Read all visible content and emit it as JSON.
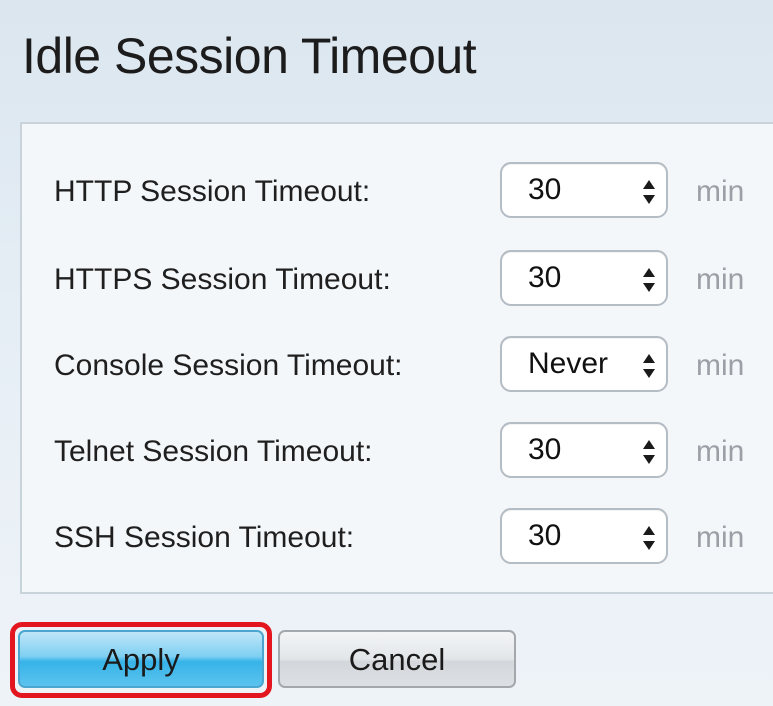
{
  "section": {
    "title": "Idle Session Timeout"
  },
  "settings": [
    {
      "label": "HTTP Session Timeout:",
      "value": "30",
      "unit": "min"
    },
    {
      "label": "HTTPS Session Timeout:",
      "value": "30",
      "unit": "min"
    },
    {
      "label": "Console Session Timeout:",
      "value": "Never",
      "unit": "min"
    },
    {
      "label": "Telnet Session Timeout:",
      "value": "30",
      "unit": "min"
    },
    {
      "label": "SSH Session Timeout:",
      "value": "30",
      "unit": "min"
    }
  ],
  "actions": {
    "apply_label": "Apply",
    "cancel_label": "Cancel"
  },
  "colors": {
    "highlight": "#e3161f",
    "apply_button": "#36b3e8",
    "unit_text": "#9aa0a6"
  },
  "icons": {
    "select_arrows": "updown-chevron-icon"
  }
}
